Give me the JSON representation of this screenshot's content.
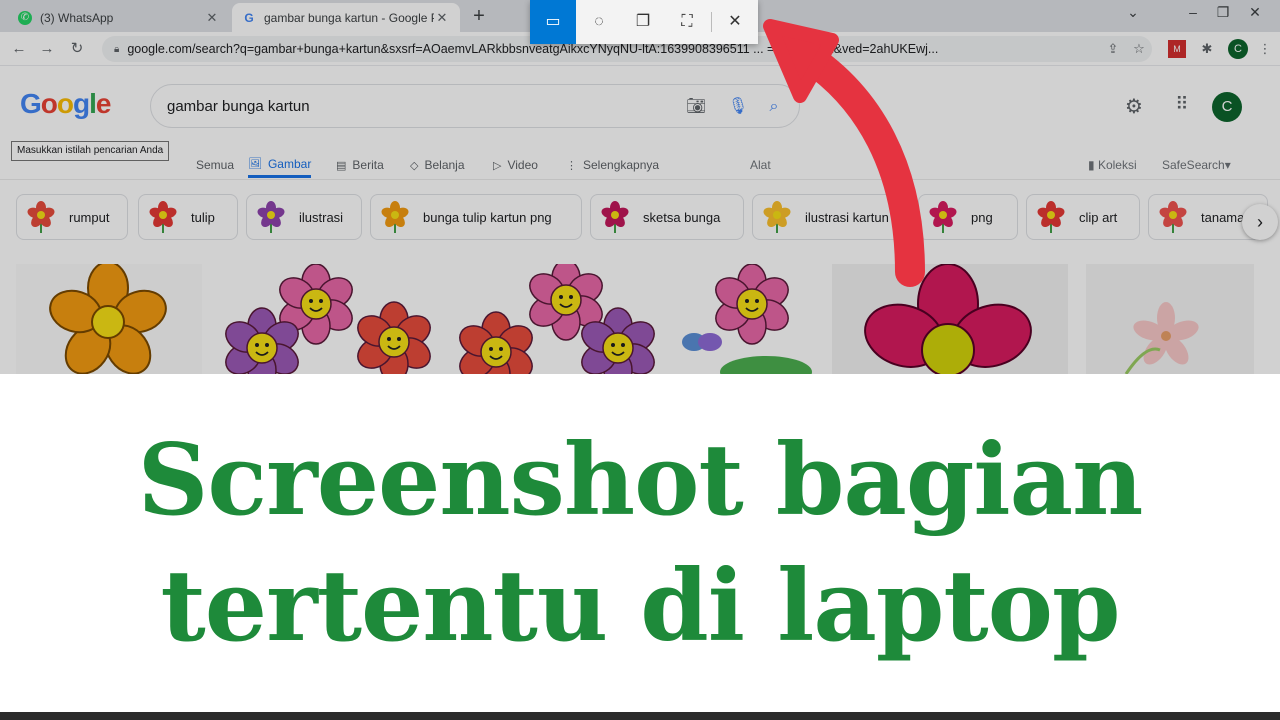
{
  "browser": {
    "tabs": [
      {
        "label": "(3) WhatsApp",
        "favicon": "whatsapp-icon",
        "state": "inactive"
      },
      {
        "label": "gambar bunga kartun - Google P",
        "favicon": "google-g-icon",
        "state": "active"
      }
    ],
    "new_tab_glyph": "+",
    "url": "google.com/search?q=gambar+bunga+kartun&sxsrf=AOaemvLARkbbsnveatgAikxcYNyqNU-ltA:1639908396511 ... =isch&sa=X&ved=2ahUKEwj...",
    "profile_initial": "C"
  },
  "google": {
    "logo": "Google",
    "logo_colors": [
      "#4285f4",
      "#ea4335",
      "#fbbc05",
      "#4285f4",
      "#34a853",
      "#ea4335"
    ],
    "query": "gambar bunga kartun",
    "tooltip": "Masukkan istilah pencarian Anda",
    "profile_initial": "C",
    "tabs": [
      {
        "label": "Semua",
        "icon": "search-icon"
      },
      {
        "label": "Gambar",
        "icon": "image-icon",
        "selected": true
      },
      {
        "label": "Berita",
        "icon": "news-icon"
      },
      {
        "label": "Belanja",
        "icon": "tag-icon"
      },
      {
        "label": "Video",
        "icon": "play-icon"
      },
      {
        "label": "Selengkapnya",
        "icon": "more-vert-icon"
      }
    ],
    "tools_label": "Alat",
    "collections_label": "Koleksi",
    "safesearch_label": "SafeSearch",
    "chips": [
      {
        "label": "rumput",
        "color": "#e74c3c"
      },
      {
        "label": "tulip",
        "color": "#e53935"
      },
      {
        "label": "ilustrasi",
        "color": "#8e44ad"
      },
      {
        "label": "bunga tulip kartun png",
        "color": "#f39c12"
      },
      {
        "label": "sketsa bunga",
        "color": "#c2185b"
      },
      {
        "label": "ilustrasi kartun",
        "color": "#fbc02d"
      },
      {
        "label": "png",
        "color": "#d81b60"
      },
      {
        "label": "clip art",
        "color": "#e53935"
      },
      {
        "label": "tanaman",
        "color": "#ef5350"
      }
    ]
  },
  "snip_toolbar": {
    "modes": [
      {
        "name": "rectangle",
        "icon": "rectangle-snip-icon",
        "active": true
      },
      {
        "name": "freeform",
        "icon": "freeform-snip-icon"
      },
      {
        "name": "window",
        "icon": "window-snip-icon"
      },
      {
        "name": "fullscreen",
        "icon": "fullscreen-snip-icon"
      }
    ],
    "close_icon": "close-icon"
  },
  "annotation": {
    "arrow_color": "#e53340"
  },
  "caption": {
    "line1": "Screenshot bagian",
    "line2": "tertentu di laptop",
    "color": "#1e8a3a"
  }
}
